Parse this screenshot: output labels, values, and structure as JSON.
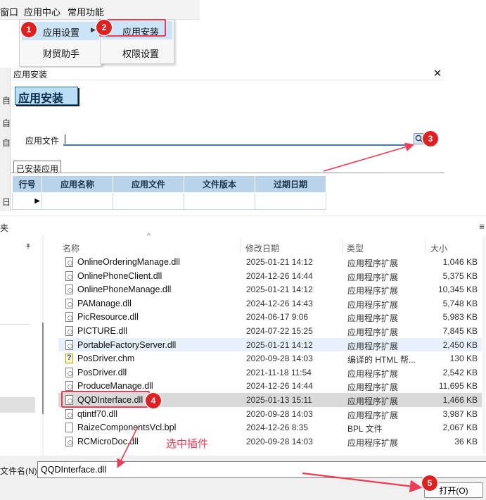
{
  "menubar": {
    "items": [
      "窗口",
      "应用中心",
      "常用功能"
    ],
    "window_fragment": "窗口"
  },
  "menu_popup": {
    "items": [
      "应用设置",
      "财贸助手"
    ],
    "submenu_arrow": "▶"
  },
  "submenu": {
    "items": [
      "应用安装",
      "权限设置"
    ]
  },
  "steps": [
    "1",
    "2",
    "3",
    "4",
    "5"
  ],
  "dialog": {
    "title": "应用安装",
    "close_glyph": "✕",
    "heading": "应用安装",
    "file_label": "应用文件",
    "file_value": "",
    "tab_label": "已安装应用",
    "left_strip_chars": [
      "自",
      "自",
      "自",
      "日"
    ],
    "grid_headers": [
      "行号",
      "应用名称",
      "应用文件",
      "文件版本",
      "过期日期"
    ],
    "row_indicator": "▶"
  },
  "file_dialog": {
    "title_fragment": "夹",
    "menu_glyph": "≡",
    "pin_glyph": "📌",
    "columns": [
      "名称",
      "修改日期",
      "类型",
      "大小"
    ],
    "sort_glyph": "^",
    "files": [
      {
        "name": "OnlineOrderingManage.dll",
        "date": "2025-01-21 14:12",
        "type": "应用程序扩展",
        "size": "1,046 KB",
        "icon": "dll"
      },
      {
        "name": "OnlinePhoneClient.dll",
        "date": "2024-12-26 14:44",
        "type": "应用程序扩展",
        "size": "5,375 KB",
        "icon": "dll"
      },
      {
        "name": "OnlinePhoneManage.dll",
        "date": "2025-01-21 14:12",
        "type": "应用程序扩展",
        "size": "10,345 KB",
        "icon": "dll"
      },
      {
        "name": "PAManage.dll",
        "date": "2024-12-26 14:43",
        "type": "应用程序扩展",
        "size": "5,748 KB",
        "icon": "dll"
      },
      {
        "name": "PicResource.dll",
        "date": "2024-06-17 9:06",
        "type": "应用程序扩展",
        "size": "5,983 KB",
        "icon": "dll"
      },
      {
        "name": "PICTURE.dll",
        "date": "2024-07-22 15:25",
        "type": "应用程序扩展",
        "size": "7,845 KB",
        "icon": "dll"
      },
      {
        "name": "PortableFactoryServer.dll",
        "date": "2025-01-21 14:12",
        "type": "应用程序扩展",
        "size": "2,450 KB",
        "icon": "dll"
      },
      {
        "name": "PosDriver.chm",
        "date": "2020-09-28 14:03",
        "type": "编译的 HTML 帮...",
        "size": "130 KB",
        "icon": "chm"
      },
      {
        "name": "PosDriver.dll",
        "date": "2021-11-18 11:54",
        "type": "应用程序扩展",
        "size": "2,542 KB",
        "icon": "dll"
      },
      {
        "name": "ProduceManage.dll",
        "date": "2024-12-26 14:44",
        "type": "应用程序扩展",
        "size": "11,695 KB",
        "icon": "dll"
      },
      {
        "name": "QQDInterface.dll",
        "date": "2025-01-13 15:11",
        "type": "应用程序扩展",
        "size": "1,466 KB",
        "icon": "dll"
      },
      {
        "name": "qtintf70.dll",
        "date": "2020-09-28 14:03",
        "type": "应用程序扩展",
        "size": "3,987 KB",
        "icon": "dll"
      },
      {
        "name": "RaizeComponentsVcl.bpl",
        "date": "2024-12-26 8:35",
        "type": "BPL 文件",
        "size": "2,067 KB",
        "icon": "plain"
      },
      {
        "name": "RCMicroDoc.dll",
        "date": "2020-09-28 14:03",
        "type": "应用程序扩展",
        "size": "36 KB",
        "icon": "dll"
      }
    ],
    "filename_label": "文件名(N):",
    "filename_value": "QQDInterface.dll",
    "open_button": "打开(O)"
  },
  "annotation": {
    "text": "选中插件",
    "color": "#ef3b54"
  },
  "colors": {
    "highlight_red": "#ef3b54",
    "step_red": "#e0201f",
    "menu_highlight": "#cce4f7",
    "grid_header": "#b8d3ea",
    "input_underline": "#3c79c8"
  }
}
